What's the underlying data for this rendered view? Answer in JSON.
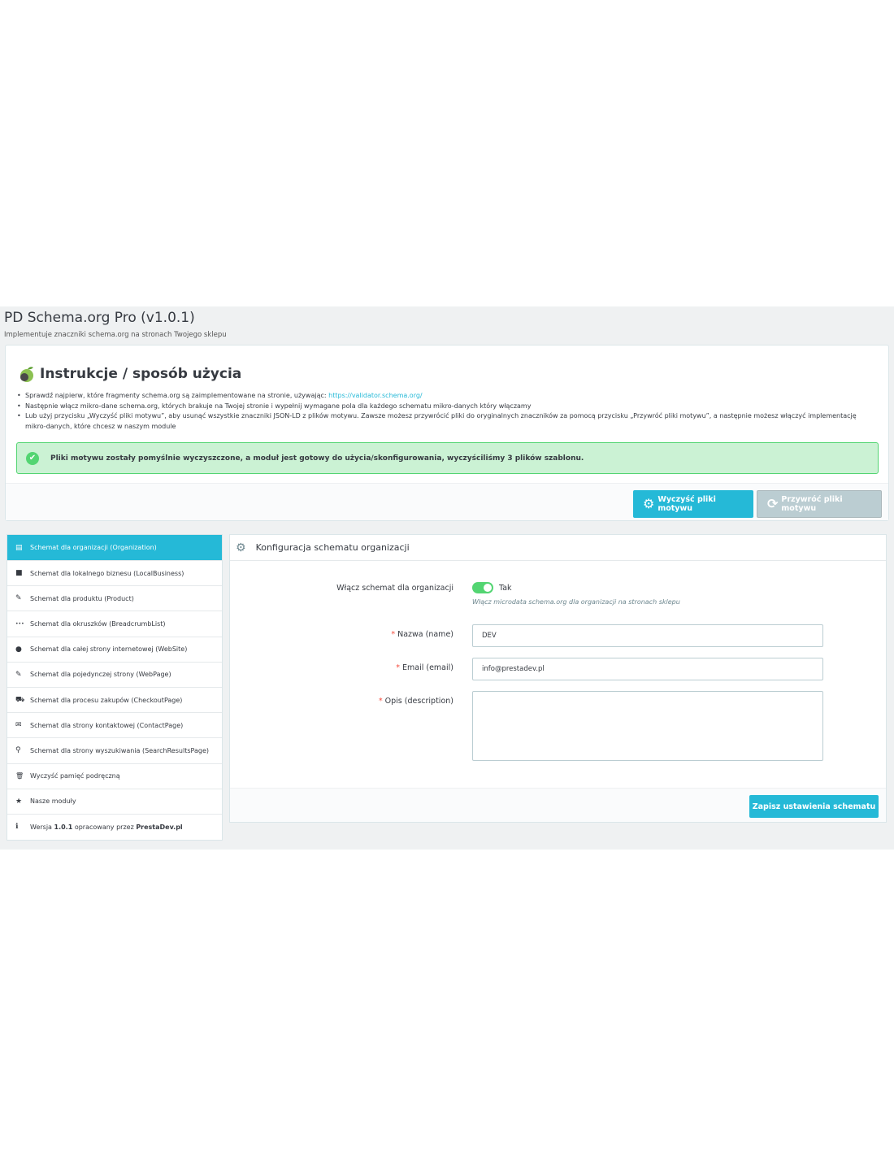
{
  "header": {
    "title": "PD Schema.org Pro (v1.0.1)",
    "subtitle": "Implementuje znaczniki schema.org na stronach Twojego sklepu"
  },
  "instructions": {
    "title": "Instrukcje / sposób użycia",
    "items": [
      {
        "text": "Sprawdź najpierw, które fragmenty schema.org są zaimplementowane na stronie, używając:",
        "link": "https://validator.schema.org/"
      },
      {
        "text": "Następnie włącz mikro-dane schema.org, których brakuje na Twojej stronie i wypełnij wymagane pola dla każdego schematu mikro-danych który włączamy"
      },
      {
        "text": "Lub użyj przycisku „Wyczyść pliki motywu”, aby usunąć wszystkie znaczniki JSON-LD z plików motywu. Zawsze możesz przywrócić pliki do oryginalnych znaczników za pomocą przycisku „Przywróć pliki motywu”, a następnie możesz włączyć implementację mikro-danych, które chcesz w naszym module"
      }
    ],
    "alert": "Pliki motywu zostały pomyślnie wyczyszczone, a moduł jest gotowy do użycia/skonfigurowania, wyczyściliśmy 3 plików szablonu.",
    "clean_button": "Wyczyść pliki motywu",
    "restore_button": "Przywróć pliki motywu"
  },
  "sidebar": {
    "items": [
      {
        "label": "Schemat dla organizacji (Organization)",
        "icon": "building-icon",
        "glyph": "▤",
        "active": true
      },
      {
        "label": "Schemat dla lokalnego biznesu (LocalBusiness)",
        "icon": "briefcase-icon",
        "glyph": "■"
      },
      {
        "label": "Schemat dla produktu (Product)",
        "icon": "pencil-icon",
        "glyph": "✎"
      },
      {
        "label": "Schemat dla okruszków (BreadcrumbList)",
        "icon": "ellipsis-icon",
        "glyph": "•••"
      },
      {
        "label": "Schemat dla całej strony internetowej (WebSite)",
        "icon": "globe-icon",
        "glyph": "●"
      },
      {
        "label": "Schemat dla pojedynczej strony (WebPage)",
        "icon": "pencil-icon",
        "glyph": "✎"
      },
      {
        "label": "Schemat dla procesu zakupów (CheckoutPage)",
        "icon": "cart-icon",
        "glyph": "⛟"
      },
      {
        "label": "Schemat dla strony kontaktowej (ContactPage)",
        "icon": "envelope-icon",
        "glyph": "✉"
      },
      {
        "label": "Schemat dla strony wyszukiwania (SearchResultsPage)",
        "icon": "search-icon",
        "glyph": "⚲"
      },
      {
        "label": "Wyczyść pamięć podręczną",
        "icon": "trash-icon",
        "glyph": "🗑"
      },
      {
        "label": "Nasze moduły",
        "icon": "star-icon",
        "glyph": "★"
      }
    ],
    "version": {
      "prefix": "Wersja",
      "number": "1.0.1",
      "middle": "opracowany przez",
      "author": "PrestaDev.pl"
    }
  },
  "config": {
    "title": "Konfiguracja schematu organizacji",
    "enable_label": "Włącz schemat dla organizacji",
    "enable_value": "Tak",
    "enable_help": "Włącz microdata schema.org dla organizacji na stronach sklepu",
    "name_label": "Nazwa (name)",
    "name_value": "DEV",
    "email_label": "Email (email)",
    "email_value": "info@prestadev.pl",
    "description_label": "Opis (description)",
    "description_value": "",
    "save_button": "Zapisz ustawienia schematu"
  },
  "colors": {
    "accent": "#25b9d7",
    "success_bg": "#cbf2d4",
    "success_border": "#53d572",
    "background": "#eff1f2"
  }
}
